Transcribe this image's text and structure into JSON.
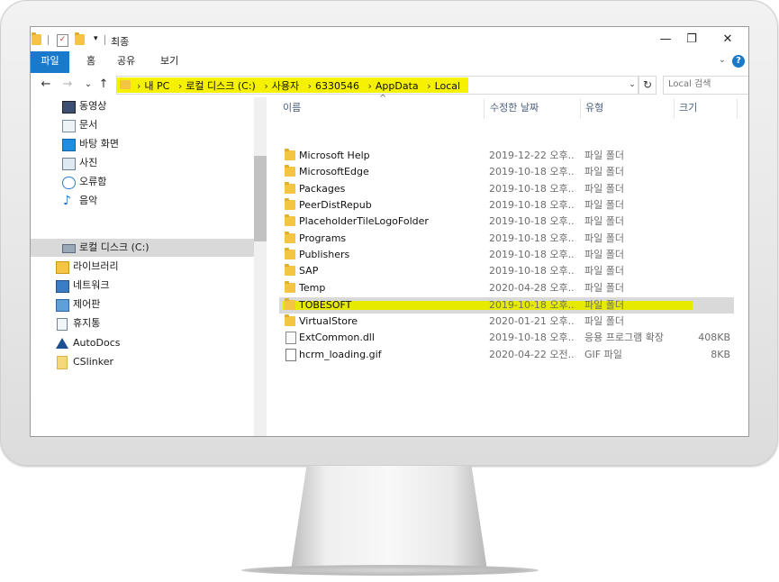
{
  "window": {
    "title": "최종",
    "qa_dropdown": "▾",
    "minimize": "—",
    "maximize": "❐",
    "close": "✕"
  },
  "ribbon": {
    "tabs": [
      "파일",
      "홈",
      "공유",
      "보기"
    ],
    "collapse": "⌄",
    "help": "?"
  },
  "nav": {
    "back": "←",
    "forward": "→",
    "recent": "⌄",
    "up": "↑",
    "address": {
      "crumbs": [
        "내 PC",
        "로컬 디스크 (C:)",
        "사용자",
        "6330546",
        "AppData",
        "Local"
      ],
      "separator": "›",
      "dropdown": "⌄",
      "highlight_color": "#f5f100"
    },
    "refresh": "↻",
    "search_placeholder": "Local 검색"
  },
  "navpane": {
    "items": [
      {
        "label": "동영상",
        "icon": "video-icon"
      },
      {
        "label": "문서",
        "icon": "document-icon"
      },
      {
        "label": "바탕 화면",
        "icon": "desktop-icon"
      },
      {
        "label": "사진",
        "icon": "pictures-icon"
      },
      {
        "label": "오류함",
        "icon": "cloud-icon"
      },
      {
        "label": "음악",
        "icon": "music-icon"
      },
      {
        "label": "로컬 디스크 (C:)",
        "icon": "drive-icon",
        "selected": true
      },
      {
        "label": "라이브러리",
        "icon": "library-icon"
      },
      {
        "label": "네트워크",
        "icon": "network-icon"
      },
      {
        "label": "제어판",
        "icon": "control-panel-icon"
      },
      {
        "label": "휴지통",
        "icon": "recycle-bin-icon"
      },
      {
        "label": "AutoDocs",
        "icon": "autodocs-icon"
      },
      {
        "label": "CSlinker",
        "icon": "folder-icon"
      }
    ]
  },
  "content": {
    "columns": {
      "name": "이름",
      "date": "수정한 날짜",
      "type": "유형",
      "size": "크기",
      "sort_indicator": "^"
    },
    "rows": [
      {
        "name": "Microsoft Help",
        "date": "2019-12-22 오후...",
        "type": "파일 폴더",
        "size": "",
        "kind": "folder"
      },
      {
        "name": "MicrosoftEdge",
        "date": "2019-10-18 오후...",
        "type": "파일 폴더",
        "size": "",
        "kind": "folder"
      },
      {
        "name": "Packages",
        "date": "2019-10-18 오후...",
        "type": "파일 폴더",
        "size": "",
        "kind": "folder"
      },
      {
        "name": "PeerDistRepub",
        "date": "2019-10-18 오후...",
        "type": "파일 폴더",
        "size": "",
        "kind": "folder"
      },
      {
        "name": "PlaceholderTileLogoFolder",
        "date": "2019-10-18 오후...",
        "type": "파일 폴더",
        "size": "",
        "kind": "folder"
      },
      {
        "name": "Programs",
        "date": "2019-10-18 오후...",
        "type": "파일 폴더",
        "size": "",
        "kind": "folder"
      },
      {
        "name": "Publishers",
        "date": "2019-10-18 오후...",
        "type": "파일 폴더",
        "size": "",
        "kind": "folder"
      },
      {
        "name": "SAP",
        "date": "2019-10-18 오후...",
        "type": "파일 폴더",
        "size": "",
        "kind": "folder"
      },
      {
        "name": "Temp",
        "date": "2020-04-28 오후...",
        "type": "파일 폴더",
        "size": "",
        "kind": "folder"
      },
      {
        "name": "TOBESOFT",
        "date": "2019-10-18 오후...",
        "type": "파일 폴더",
        "size": "",
        "kind": "folder",
        "selected": true
      },
      {
        "name": "VirtualStore",
        "date": "2020-01-21 오후...",
        "type": "파일 폴더",
        "size": "",
        "kind": "folder"
      },
      {
        "name": "ExtCommon.dll",
        "date": "2019-10-18 오후...",
        "type": "응용 프로그램 확장",
        "size": "408KB",
        "kind": "dll"
      },
      {
        "name": "hcrm_loading.gif",
        "date": "2020-04-22 오전...",
        "type": "GIF 파일",
        "size": "8KB",
        "kind": "gif"
      }
    ],
    "highlight_color": "#e6ea00"
  }
}
